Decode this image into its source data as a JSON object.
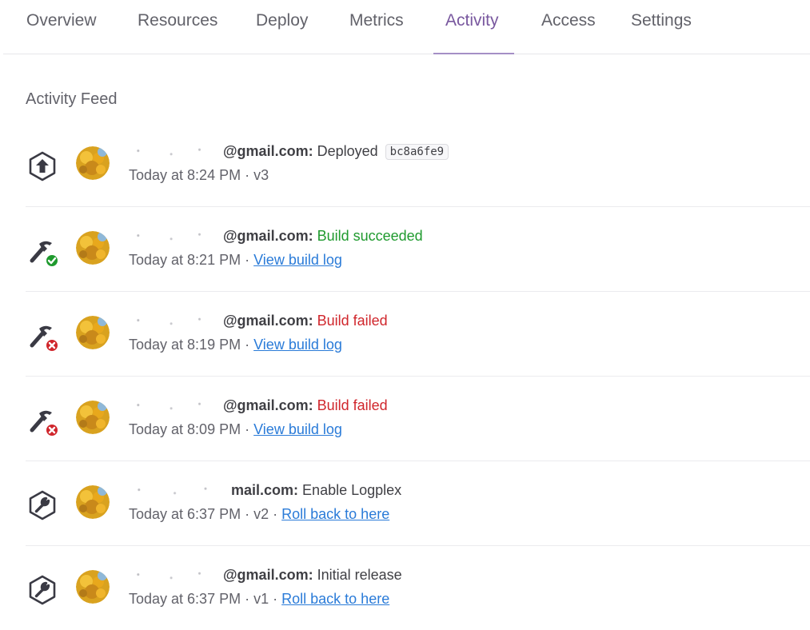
{
  "tabs": [
    {
      "label": "Overview",
      "active": false
    },
    {
      "label": "Resources",
      "active": false
    },
    {
      "label": "Deploy",
      "active": false
    },
    {
      "label": "Metrics",
      "active": false
    },
    {
      "label": "Activity",
      "active": true
    },
    {
      "label": "Access",
      "active": false
    },
    {
      "label": "Settings",
      "active": false
    }
  ],
  "feed": {
    "title": "Activity Feed",
    "items": [
      {
        "icon": "deploy-arrow-icon",
        "email": "@gmail.com:",
        "action": "Deployed",
        "sha": "bc8a6fe9",
        "time": "Today at 8:24 PM",
        "meta": "· v3"
      },
      {
        "icon": "build-succeeded-icon",
        "email": "@gmail.com:",
        "action": "Build succeeded",
        "time": "Today at 8:21 PM",
        "meta": "·",
        "link": "View build log"
      },
      {
        "icon": "build-failed-icon",
        "email": "@gmail.com:",
        "action": "Build failed",
        "time": "Today at 8:19 PM",
        "meta": "·",
        "link": "View build log"
      },
      {
        "icon": "build-failed-icon",
        "email": "@gmail.com:",
        "action": "Build failed",
        "time": "Today at 8:09 PM",
        "meta": "·",
        "link": "View build log"
      },
      {
        "icon": "config-wrench-icon",
        "email": "mail.com:",
        "action": "Enable Logplex",
        "time": "Today at 6:37 PM",
        "meta": "· v2 ·",
        "link": "Roll back to here"
      },
      {
        "icon": "config-wrench-icon",
        "email": "@gmail.com:",
        "action": "Initial release",
        "time": "Today at 6:37 PM",
        "meta": "· v1 ·",
        "link": "Roll back to here"
      }
    ]
  },
  "colors": {
    "accent": "#79589f",
    "success": "#1f9a2e",
    "error": "#d0262c",
    "link": "#2a7bd8"
  }
}
